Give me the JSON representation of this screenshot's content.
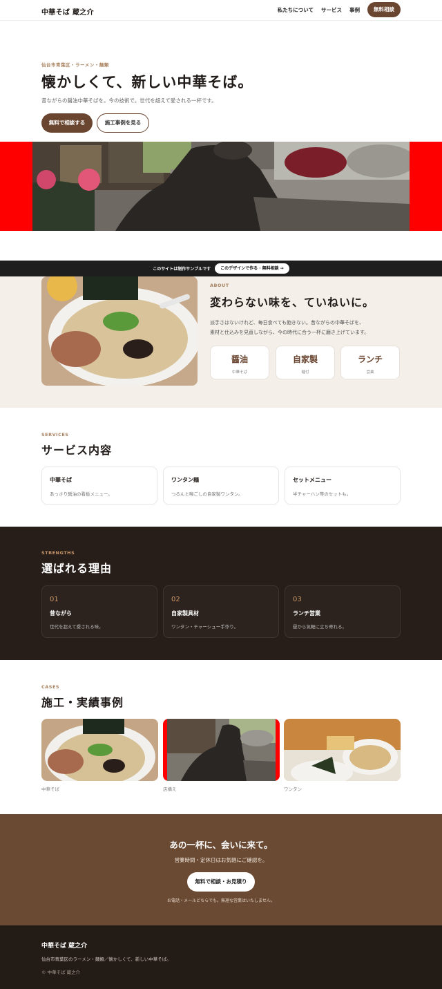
{
  "header": {
    "brand": "中華そば 蔵之介",
    "nav": [
      "私たちについて",
      "サービス",
      "事例"
    ],
    "cta": "無料相談"
  },
  "hero": {
    "eyebrow": "仙台市青葉区・ラーメン・麺類",
    "title": "懐かしくて、新しい中華そば。",
    "subtitle": "昔ながらの醤油中華そばを。今の技術で。世代を超えて愛される一杯です。",
    "primary_button": "無料で相談する",
    "secondary_button": "施工事例を見る"
  },
  "banner": {
    "text": "このサイトは制作サンプルです",
    "button": "このデザインで作る · 無料相談 →"
  },
  "about": {
    "eyebrow": "ABOUT",
    "title": "変わらない味を、ていねいに。",
    "text_line1": "派手さはないけれど、毎日食べても飽きない。昔ながらの中華そばを、",
    "text_line2": "素材と仕込みを見直しながら、今の時代に合う一杯に磨き上げています。",
    "features": [
      {
        "title": "醤油",
        "sub": "中華そば"
      },
      {
        "title": "自家製",
        "sub": "麺付"
      },
      {
        "title": "ランチ",
        "sub": "営業"
      }
    ]
  },
  "services": {
    "eyebrow": "SERVICES",
    "title": "サービス内容",
    "items": [
      {
        "title": "中華そば",
        "desc": "あっさり醤油の看板メニュー。"
      },
      {
        "title": "ワンタン麺",
        "desc": "つるんと喉ごしの自家製ワンタン。"
      },
      {
        "title": "セットメニュー",
        "desc": "半チャーハン等のセットも。"
      }
    ]
  },
  "strengths": {
    "eyebrow": "STRENGTHS",
    "title": "選ばれる理由",
    "items": [
      {
        "num": "01",
        "title": "昔ながら",
        "desc": "世代を超えて愛される味。"
      },
      {
        "num": "02",
        "title": "自家製具材",
        "desc": "ワンタン・チャーシュー手作り。"
      },
      {
        "num": "03",
        "title": "ランチ営業",
        "desc": "昼から気軽に立ち寄れる。"
      }
    ]
  },
  "cases": {
    "eyebrow": "CASES",
    "title": "施工・実績事例",
    "items": [
      {
        "caption": "中華そば"
      },
      {
        "caption": "店構え"
      },
      {
        "caption": "ワンタン"
      }
    ]
  },
  "cta": {
    "title": "あの一杯に、会いに来て。",
    "subtitle": "営業時間・定休日はお気軽にご確認を。",
    "button": "無料で相談・お見積り",
    "note": "お電話・メールどちらでも。無理な営業はいたしません。"
  },
  "footer": {
    "brand": "中華そば 蔵之介",
    "desc": "仙台市青葉区のラーメン・麺類／懐かしくて、新しい中華そば。",
    "copyright": "© 中華そば 蔵之介"
  },
  "colors": {
    "accent": "#6a4530",
    "dark": "#271e19",
    "beige": "#f4efe9",
    "image_pad": "#ff0000"
  }
}
